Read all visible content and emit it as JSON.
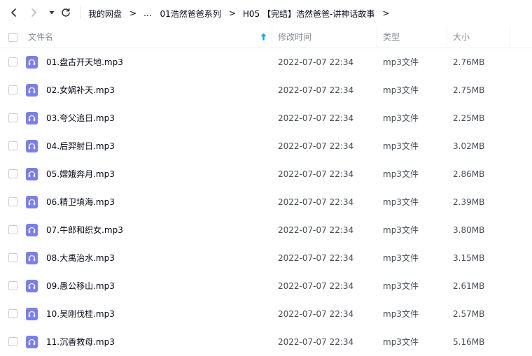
{
  "nav": {
    "back_icon": "chevron-left-icon",
    "forward_icon": "chevron-right-icon",
    "history_icon": "dropdown-triangle-icon",
    "refresh_icon": "refresh-icon"
  },
  "breadcrumb": {
    "items": [
      "我的网盘",
      "...",
      "01浩然爸爸系列",
      "H05 【完结】浩然爸爸-讲神话故事"
    ],
    "separator": ">"
  },
  "columns": {
    "name": "文件名",
    "modified": "修改时间",
    "type": "类型",
    "size": "大小"
  },
  "colors": {
    "accent": "#06a7ff",
    "audio_icon": "#7a7ef6",
    "header_text": "#878c9c"
  },
  "files": [
    {
      "name": "01.盘古开天地.mp3",
      "modified": "2022-07-07 22:34",
      "type": "mp3文件",
      "size": "2.76MB",
      "icon": "audio-file-icon"
    },
    {
      "name": "02.女娲补天.mp3",
      "modified": "2022-07-07 22:34",
      "type": "mp3文件",
      "size": "2.75MB",
      "icon": "audio-file-icon"
    },
    {
      "name": "03.夸父追日.mp3",
      "modified": "2022-07-07 22:34",
      "type": "mp3文件",
      "size": "2.25MB",
      "icon": "audio-file-icon"
    },
    {
      "name": "04.后羿射日.mp3",
      "modified": "2022-07-07 22:34",
      "type": "mp3文件",
      "size": "3.02MB",
      "icon": "audio-file-icon"
    },
    {
      "name": "05.嫦娥奔月.mp3",
      "modified": "2022-07-07 22:34",
      "type": "mp3文件",
      "size": "2.86MB",
      "icon": "audio-file-icon"
    },
    {
      "name": "06.精卫填海.mp3",
      "modified": "2022-07-07 22:34",
      "type": "mp3文件",
      "size": "2.39MB",
      "icon": "audio-file-icon"
    },
    {
      "name": "07.牛郎和织女.mp3",
      "modified": "2022-07-07 22:34",
      "type": "mp3文件",
      "size": "3.80MB",
      "icon": "audio-file-icon"
    },
    {
      "name": "08.大禹治水.mp3",
      "modified": "2022-07-07 22:34",
      "type": "mp3文件",
      "size": "3.15MB",
      "icon": "audio-file-icon"
    },
    {
      "name": "09.愚公移山.mp3",
      "modified": "2022-07-07 22:34",
      "type": "mp3文件",
      "size": "2.61MB",
      "icon": "audio-file-icon"
    },
    {
      "name": "10.吴刚伐桂.mp3",
      "modified": "2022-07-07 22:34",
      "type": "mp3文件",
      "size": "2.57MB",
      "icon": "audio-file-icon"
    },
    {
      "name": "11.沉香救母.mp3",
      "modified": "2022-07-07 22:34",
      "type": "mp3文件",
      "size": "5.16MB",
      "icon": "audio-file-icon"
    }
  ]
}
